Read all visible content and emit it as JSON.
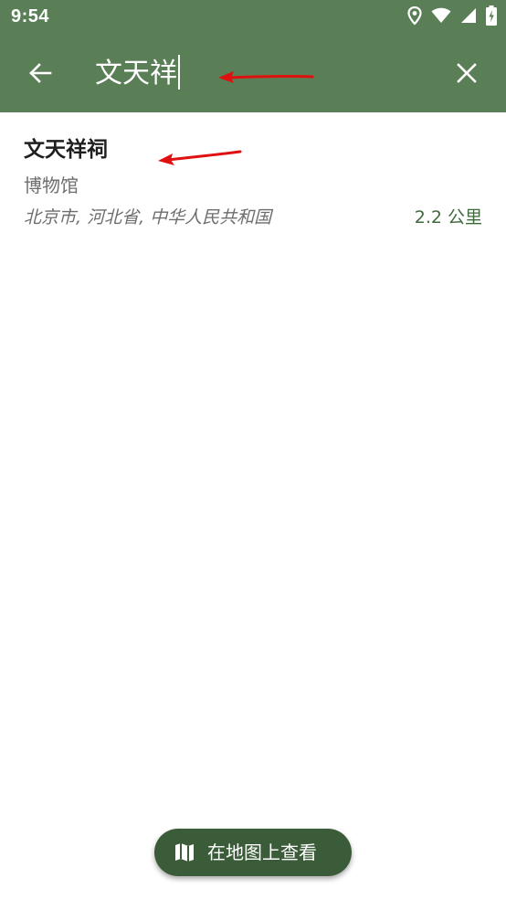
{
  "status_bar": {
    "time": "9:54",
    "icons": [
      "location-icon",
      "wifi-icon",
      "signal-icon",
      "battery-charging-icon"
    ]
  },
  "app_bar": {
    "search_value": "文天祥",
    "back_icon": "arrow-left-icon",
    "clear_icon": "close-icon",
    "colors": {
      "background": "#5a7f56",
      "text": "#ffffff"
    }
  },
  "results": [
    {
      "title": "文天祥祠",
      "category": "博物馆",
      "address": "北京市, 河北省, 中华人民共和国",
      "distance": "2.2 公里"
    }
  ],
  "fab": {
    "label": "在地图上查看",
    "icon": "map-icon",
    "color": "#3b5c38"
  },
  "annotations": {
    "arrow_color": "#e01010"
  }
}
